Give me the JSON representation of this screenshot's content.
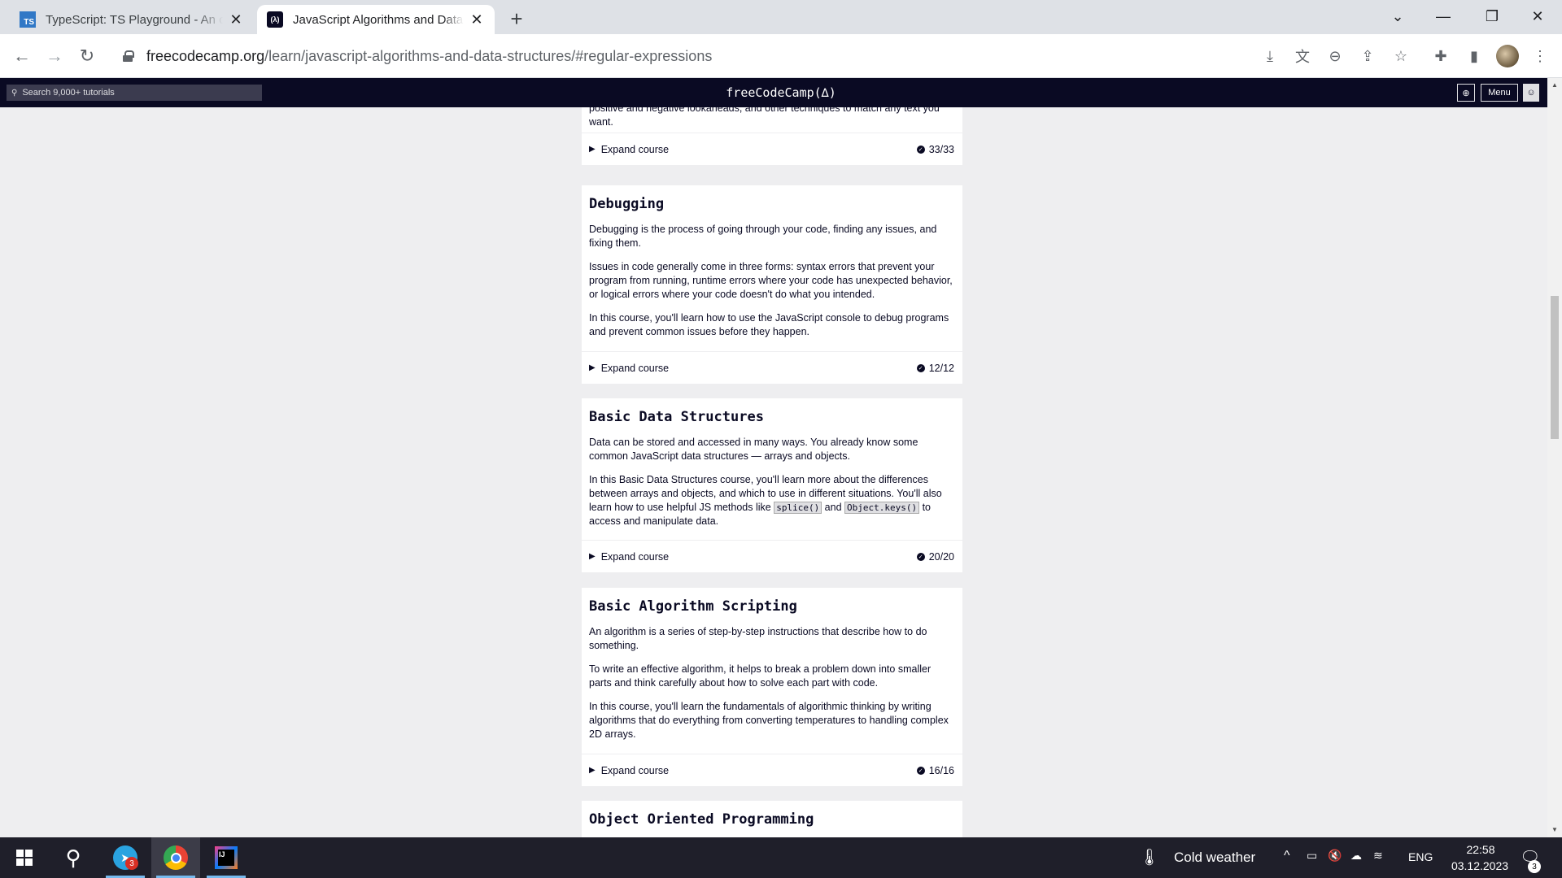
{
  "browser": {
    "tabs": [
      {
        "title": "TypeScript: TS Playground - An online editor for exploring TypeScript",
        "favicon": "TS",
        "active": false
      },
      {
        "title": "JavaScript Algorithms and Data Structures",
        "favicon": "(λ)",
        "active": true
      }
    ],
    "url_host": "freecodecamp.org",
    "url_path": "/learn/javascript-algorithms-and-data-structures/#regular-expressions"
  },
  "fcc_nav": {
    "search_placeholder": "Search 9,000+ tutorials",
    "logo": "freeCodeCamp(∆)",
    "menu_label": "Menu"
  },
  "courses": [
    {
      "title": "",
      "paragraphs": [
        "positive and negative lookaheads, and other techniques to match any text you want."
      ],
      "expand_label": "Expand course",
      "progress": "33/33"
    },
    {
      "title": "Debugging",
      "paragraphs": [
        "Debugging is the process of going through your code, finding any issues, and fixing them.",
        "Issues in code generally come in three forms: syntax errors that prevent your program from running, runtime errors where your code has unexpected behavior, or logical errors where your code doesn't do what you intended.",
        "In this course, you'll learn how to use the JavaScript console to debug programs and prevent common issues before they happen."
      ],
      "expand_label": "Expand course",
      "progress": "12/12"
    },
    {
      "title": "Basic Data Structures",
      "paragraphs": [
        "Data can be stored and accessed in many ways. You already know some common JavaScript data structures — arrays and objects."
      ],
      "p2_parts": {
        "a": "In this Basic Data Structures course, you'll learn more about the differences between arrays and objects, and which to use in different situations. You'll also learn how to use helpful JS methods like ",
        "code1": "splice()",
        "b": " and ",
        "code2": "Object.keys()",
        "c": " to access and manipulate data."
      },
      "expand_label": "Expand course",
      "progress": "20/20"
    },
    {
      "title": "Basic Algorithm Scripting",
      "paragraphs": [
        "An algorithm is a series of step-by-step instructions that describe how to do something.",
        "To write an effective algorithm, it helps to break a problem down into smaller parts and think carefully about how to solve each part with code.",
        "In this course, you'll learn the fundamentals of algorithmic thinking by writing algorithms that do everything from converting temperatures to handling complex 2D arrays."
      ],
      "expand_label": "Expand course",
      "progress": "16/16"
    },
    {
      "title": "Object Oriented Programming"
    }
  ],
  "taskbar": {
    "weather": "Cold weather",
    "language": "ENG",
    "time": "22:58",
    "date": "03.12.2023",
    "telegram_badge": "3",
    "notification_badge": "3"
  }
}
